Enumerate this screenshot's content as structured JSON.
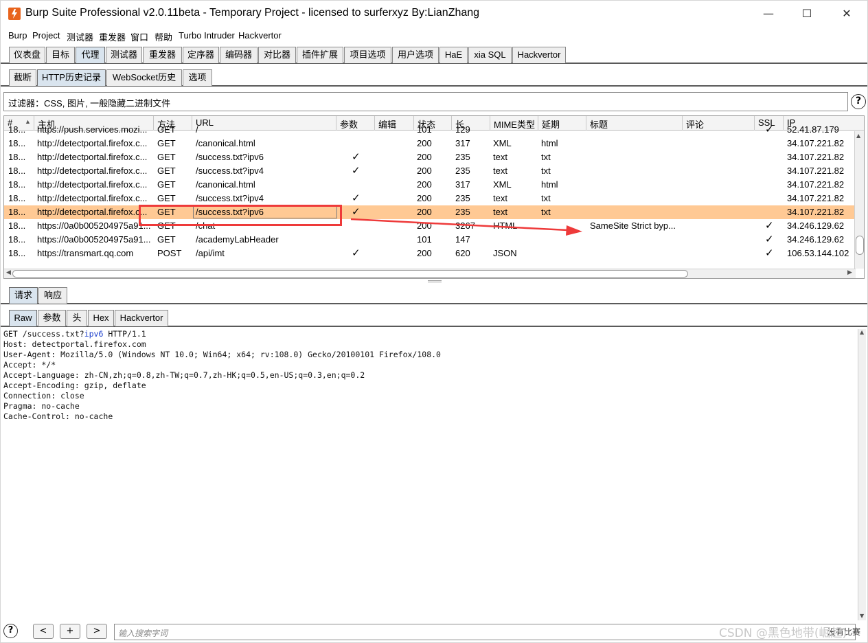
{
  "window": {
    "title": "Burp Suite Professional v2.0.11beta - Temporary Project - licensed to surferxyz By:LianZhang",
    "minimize": "—",
    "maximize": "☐",
    "close": "✕"
  },
  "menu": [
    "Burp",
    "Project",
    "测试器",
    "重发器",
    "窗口",
    "帮助",
    "Turbo Intruder",
    "Hackvertor"
  ],
  "main_tabs": [
    "仪表盘",
    "目标",
    "代理",
    "测试器",
    "重发器",
    "定序器",
    "编码器",
    "对比器",
    "插件扩展",
    "项目选项",
    "用户选项",
    "HaE",
    "xia SQL",
    "Hackvertor"
  ],
  "main_tabs_selected": "代理",
  "proxy_tabs": [
    "截断",
    "HTTP历史记录",
    "WebSocket历史",
    "选项"
  ],
  "proxy_tabs_selected": "HTTP历史记录",
  "filter_text": "过滤器：CSS, 图片, 一般隐藏二进制文件",
  "help_glyph": "?",
  "columns": [
    "#",
    "主机",
    "方法",
    "URL",
    "参数",
    "编辑",
    "状态",
    "长",
    "MIME类型",
    "延期",
    "标题",
    "评论",
    "SSL",
    "IP"
  ],
  "sort_arrow": "▲",
  "rows": [
    {
      "num": "18...",
      "host": "https://push.services.mozi...",
      "method": "GET",
      "url": "/",
      "params": "",
      "status": "101",
      "length": "129",
      "mime": "",
      "ext": "",
      "title": "",
      "ssl": "✓",
      "ip": "52.41.87.179",
      "highlight": false
    },
    {
      "num": "18...",
      "host": "http://detectportal.firefox.c...",
      "method": "GET",
      "url": "/canonical.html",
      "params": "",
      "status": "200",
      "length": "317",
      "mime": "XML",
      "ext": "html",
      "title": "",
      "ssl": "",
      "ip": "34.107.221.82",
      "highlight": false
    },
    {
      "num": "18...",
      "host": "http://detectportal.firefox.c...",
      "method": "GET",
      "url": "/success.txt?ipv6",
      "params": "✓",
      "status": "200",
      "length": "235",
      "mime": "text",
      "ext": "txt",
      "title": "",
      "ssl": "",
      "ip": "34.107.221.82",
      "highlight": false
    },
    {
      "num": "18...",
      "host": "http://detectportal.firefox.c...",
      "method": "GET",
      "url": "/success.txt?ipv4",
      "params": "✓",
      "status": "200",
      "length": "235",
      "mime": "text",
      "ext": "txt",
      "title": "",
      "ssl": "",
      "ip": "34.107.221.82",
      "highlight": false
    },
    {
      "num": "18...",
      "host": "http://detectportal.firefox.c...",
      "method": "GET",
      "url": "/canonical.html",
      "params": "",
      "status": "200",
      "length": "317",
      "mime": "XML",
      "ext": "html",
      "title": "",
      "ssl": "",
      "ip": "34.107.221.82",
      "highlight": false
    },
    {
      "num": "18...",
      "host": "http://detectportal.firefox.c...",
      "method": "GET",
      "url": "/success.txt?ipv4",
      "params": "✓",
      "status": "200",
      "length": "235",
      "mime": "text",
      "ext": "txt",
      "title": "",
      "ssl": "",
      "ip": "34.107.221.82",
      "highlight": false
    },
    {
      "num": "18...",
      "host": "http://detectportal.firefox.c...",
      "method": "GET",
      "url": "/success.txt?ipv6",
      "params": "✓",
      "status": "200",
      "length": "235",
      "mime": "text",
      "ext": "txt",
      "title": "",
      "ssl": "",
      "ip": "34.107.221.82",
      "highlight": true
    },
    {
      "num": "18...",
      "host": "https://0a0b005204975a91...",
      "method": "GET",
      "url": "/chat",
      "params": "",
      "status": "200",
      "length": "3267",
      "mime": "HTML",
      "ext": "",
      "title": "SameSite Strict byp...",
      "ssl": "✓",
      "ip": "34.246.129.62",
      "highlight": false
    },
    {
      "num": "18...",
      "host": "https://0a0b005204975a91...",
      "method": "GET",
      "url": "/academyLabHeader",
      "params": "",
      "status": "101",
      "length": "147",
      "mime": "",
      "ext": "",
      "title": "",
      "ssl": "✓",
      "ip": "34.246.129.62",
      "highlight": false
    },
    {
      "num": "18...",
      "host": "https://transmart.qq.com",
      "method": "POST",
      "url": "/api/imt",
      "params": "✓",
      "status": "200",
      "length": "620",
      "mime": "JSON",
      "ext": "",
      "title": "",
      "ssl": "✓",
      "ip": "106.53.144.102",
      "highlight": false
    }
  ],
  "req_resp_tabs": [
    "请求",
    "响应"
  ],
  "req_resp_selected": "请求",
  "view_tabs": [
    "Raw",
    "参数",
    "头",
    "Hex",
    "Hackvertor"
  ],
  "view_selected": "Raw",
  "request_lines": {
    "l1_a": "GET /success.txt?",
    "l1_b": "ipv6",
    "l1_c": " HTTP/1.1",
    "l2": "Host: detectportal.firefox.com",
    "l3": "User-Agent: Mozilla/5.0 (Windows NT 10.0; Win64; x64; rv:108.0) Gecko/20100101 Firefox/108.0",
    "l4": "Accept: */*",
    "l5": "Accept-Language: zh-CN,zh;q=0.8,zh-TW;q=0.7,zh-HK;q=0.5,en-US;q=0.3,en;q=0.2",
    "l6": "Accept-Encoding: gzip, deflate",
    "l7": "Connection: close",
    "l8": "Pragma: no-cache",
    "l9": "Cache-Control: no-cache"
  },
  "bottom": {
    "help": "?",
    "prev": "<",
    "add": "+",
    "next": ">",
    "search_placeholder": "输入搜索字词",
    "no_match": "没有比赛"
  },
  "watermark": "CSDN @黑色地带(崛起)",
  "colors": {
    "highlight_row": "#ffc994",
    "annotation": "#ee3a3a",
    "param_highlight": "#1a3dcc"
  }
}
